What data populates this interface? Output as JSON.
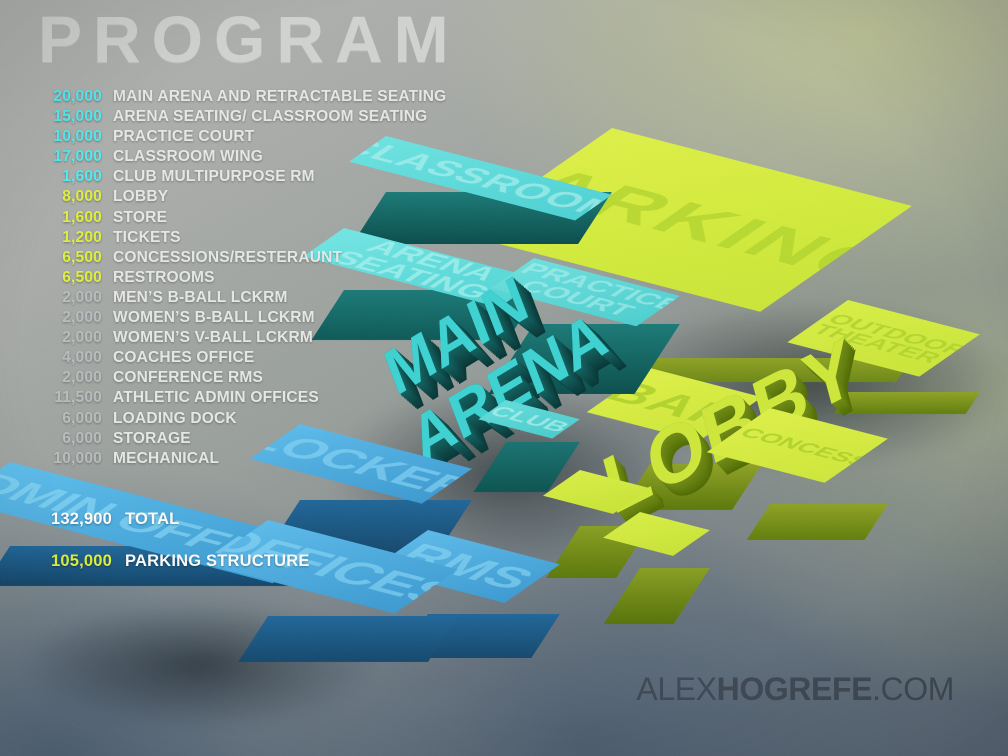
{
  "title": "PROGRAM",
  "legend": {
    "items": [
      {
        "qty": "20,000",
        "label": "MAIN ARENA AND RETRACTABLE SEATING",
        "color_group": "cyan"
      },
      {
        "qty": "15,000",
        "label": "ARENA SEATING/ CLASSROOM SEATING",
        "color_group": "cyan"
      },
      {
        "qty": "10,000",
        "label": "PRACTICE COURT",
        "color_group": "cyan"
      },
      {
        "qty": "17,000",
        "label": "CLASSROOM WING",
        "color_group": "cyan"
      },
      {
        "qty": "1,600",
        "label": "CLUB MULTIPURPOSE RM",
        "color_group": "cyan"
      },
      {
        "qty": "8,000",
        "label": "LOBBY",
        "color_group": "lime"
      },
      {
        "qty": "1,600",
        "label": "STORE",
        "color_group": "lime"
      },
      {
        "qty": "1,200",
        "label": "TICKETS",
        "color_group": "lime"
      },
      {
        "qty": "6,500",
        "label": "CONCESSIONS/RESTERAUNT",
        "color_group": "lime"
      },
      {
        "qty": "6,500",
        "label": "RESTROOMS",
        "color_group": "lime"
      },
      {
        "qty": "2,000",
        "label": "MEN’S B-BALL LCKRM",
        "color_group": "gray"
      },
      {
        "qty": "2,000",
        "label": "WOMEN’S B-BALL LCKRM",
        "color_group": "gray"
      },
      {
        "qty": "2,000",
        "label": "WOMEN’S V-BALL LCKRM",
        "color_group": "gray"
      },
      {
        "qty": "4,000",
        "label": "COACHES OFFICE",
        "color_group": "gray"
      },
      {
        "qty": "2,000",
        "label": "CONFERENCE RMS",
        "color_group": "gray"
      },
      {
        "qty": "11,500",
        "label": "ATHLETIC ADMIN OFFICES",
        "color_group": "gray"
      },
      {
        "qty": "6,000",
        "label": "LOADING DOCK",
        "color_group": "gray"
      },
      {
        "qty": "6,000",
        "label": "STORAGE",
        "color_group": "gray"
      },
      {
        "qty": "10,000",
        "label": "MECHANICAL",
        "color_group": "gray"
      }
    ],
    "totals": [
      {
        "qty": "132,900",
        "label": "TOTAL",
        "color_group": "white"
      },
      {
        "qty": "105,000",
        "label": "PARKING STRUCTURE",
        "color_group": "lime"
      }
    ]
  },
  "signature": {
    "light1": "ALEX",
    "bold": "HOGREFE",
    "light2": ".COM"
  },
  "colors": {
    "cyan": "#52ecf2",
    "lime": "#dff03e",
    "gray": "#b9bdbd",
    "white": "#ffffff",
    "title_gray": "#d2d4d2",
    "teal_top": "#5fdede",
    "teal_side": "#12605f",
    "blue_top": "#56b9e8",
    "blue_side": "#1d5c86",
    "green_top": "#d6ef45",
    "green_side": "#6e8a18",
    "signature": "#3d4650"
  },
  "massing": {
    "blocks": [
      {
        "name": "classroom-wing",
        "label": "CLASSROOM",
        "palette": "teal"
      },
      {
        "name": "arena-seating",
        "label": "ARENA SEATING",
        "palette": "teal"
      },
      {
        "name": "practice-court",
        "label": "PRACTICE COURT",
        "palette": "teal"
      },
      {
        "name": "main-arena",
        "label": "MAIN ARENA",
        "palette": "teal"
      },
      {
        "name": "club",
        "label": "CLUB",
        "palette": "teal"
      },
      {
        "name": "parking",
        "label": "PARKING",
        "palette": "green"
      },
      {
        "name": "outdoor-theater",
        "label": "OUTDOOR THEATER",
        "palette": "green"
      },
      {
        "name": "bar",
        "label": "BAR",
        "palette": "green"
      },
      {
        "name": "lobby",
        "label": "LOBBY",
        "palette": "green"
      },
      {
        "name": "concessions",
        "label": "CONCESSIONS",
        "palette": "green"
      },
      {
        "name": "tickets-cube",
        "label": "",
        "palette": "green"
      },
      {
        "name": "store-cube",
        "label": "",
        "palette": "green"
      },
      {
        "name": "admin-offices",
        "label": "ADMIN OFFICES",
        "palette": "blue"
      },
      {
        "name": "locker-rms",
        "label": "LOCKER",
        "palette": "blue"
      },
      {
        "name": "locker-rms-2",
        "label": "RMS",
        "palette": "blue"
      },
      {
        "name": "offices",
        "label": "OFFICES",
        "palette": "blue"
      }
    ]
  }
}
